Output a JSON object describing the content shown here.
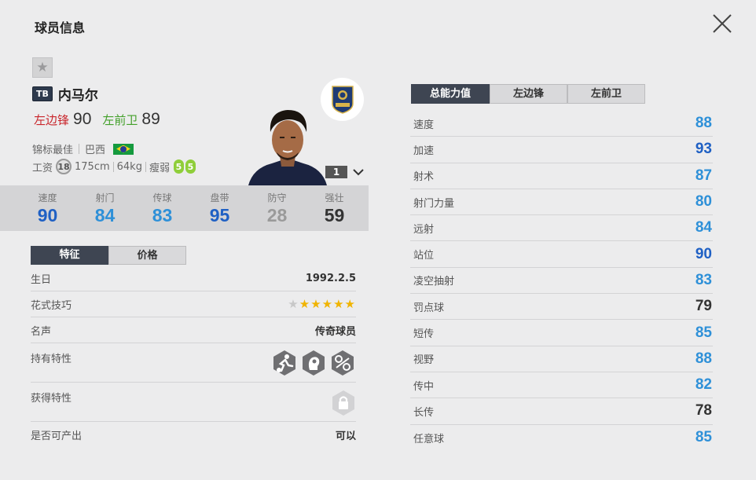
{
  "header": {
    "title": "球员信息"
  },
  "player": {
    "season_badge": "TB",
    "name": "内马尔",
    "positions": [
      {
        "label": "左边锋",
        "value": "90",
        "color": "#c9262c"
      },
      {
        "label": "左前卫",
        "value": "89",
        "color": "#43a02a"
      }
    ],
    "team_label": "锦标最佳",
    "nation": "巴西",
    "salary_label": "工资",
    "salary": "18",
    "height": "175cm",
    "weight": "64kg",
    "body_type": "瘦弱",
    "weak_foot_left": "5",
    "weak_foot_right": "5",
    "club_badge_text": "TOURNAMENT BEST",
    "level": "1"
  },
  "summary_stats": [
    {
      "label": "速度",
      "value": "90",
      "color": "#1f60c4"
    },
    {
      "label": "射门",
      "value": "84",
      "color": "#2e90d8"
    },
    {
      "label": "传球",
      "value": "83",
      "color": "#2e90d8"
    },
    {
      "label": "盘带",
      "value": "95",
      "color": "#1f60c4"
    },
    {
      "label": "防守",
      "value": "28",
      "color": "#9a9a9a"
    },
    {
      "label": "强壮",
      "value": "59",
      "color": "#333333"
    }
  ],
  "left_tabs": [
    {
      "label": "特征",
      "active": true
    },
    {
      "label": "价格",
      "active": false
    }
  ],
  "details": {
    "birthday_label": "生日",
    "birthday": "1992.2.5",
    "skill_label": "花式技巧",
    "skill_stars": 5,
    "reputation_label": "名声",
    "reputation": "传奇球员",
    "traits_label": "持有特性",
    "traits": [
      "dribbler-trait-icon",
      "flair-trait-icon",
      "nutmeg-trait-icon"
    ],
    "acquired_label": "获得特性",
    "producible_label": "是否可产出",
    "producible": "可以"
  },
  "right_tabs": [
    {
      "label": "总能力值",
      "active": true
    },
    {
      "label": "左边锋",
      "active": false
    },
    {
      "label": "左前卫",
      "active": false
    }
  ],
  "attributes": [
    {
      "label": "速度",
      "value": "88",
      "color": "#2e90d8"
    },
    {
      "label": "加速",
      "value": "93",
      "color": "#1f60c4"
    },
    {
      "label": "射术",
      "value": "87",
      "color": "#2e90d8"
    },
    {
      "label": "射门力量",
      "value": "80",
      "color": "#2e90d8"
    },
    {
      "label": "远射",
      "value": "84",
      "color": "#2e90d8"
    },
    {
      "label": "站位",
      "value": "90",
      "color": "#1f60c4"
    },
    {
      "label": "凌空抽射",
      "value": "83",
      "color": "#2e90d8"
    },
    {
      "label": "罚点球",
      "value": "79",
      "color": "#333333"
    },
    {
      "label": "短传",
      "value": "85",
      "color": "#2e90d8"
    },
    {
      "label": "视野",
      "value": "88",
      "color": "#2e90d8"
    },
    {
      "label": "传中",
      "value": "82",
      "color": "#2e90d8"
    },
    {
      "label": "长传",
      "value": "78",
      "color": "#333333"
    },
    {
      "label": "任意球",
      "value": "85",
      "color": "#2e90d8"
    }
  ]
}
